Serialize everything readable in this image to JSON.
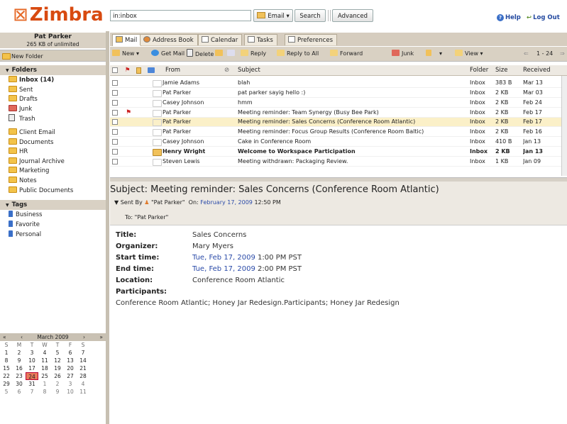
{
  "header": {
    "logo_text": "Zimbra",
    "search_value": "in:inbox",
    "email_button": "Email",
    "search_button": "Search",
    "advanced_button": "Advanced",
    "help_link": "Help",
    "logout_link": "Log Out"
  },
  "user": {
    "name": "Pat Parker",
    "quota": "265 KB of unlimited"
  },
  "sidebar": {
    "new_folder": "New Folder",
    "folders_header": "Folders",
    "folders": [
      {
        "label": "Inbox (14)",
        "bold": true
      },
      {
        "label": "Sent"
      },
      {
        "label": "Drafts"
      },
      {
        "label": "Junk"
      },
      {
        "label": "Trash"
      },
      {
        "label": "Client Email"
      },
      {
        "label": "Documents"
      },
      {
        "label": "HR"
      },
      {
        "label": "Journal Archive"
      },
      {
        "label": "Marketing"
      },
      {
        "label": "Notes"
      },
      {
        "label": "Public Documents"
      }
    ],
    "tags_header": "Tags",
    "tags": [
      {
        "label": "Business"
      },
      {
        "label": "Favorite"
      },
      {
        "label": "Personal"
      }
    ]
  },
  "calendar": {
    "month": "March 2009",
    "nav_prev_year": "«",
    "nav_prev": "‹",
    "nav_next": "›",
    "nav_next_year": "»",
    "weekdays": [
      "S",
      "M",
      "T",
      "W",
      "T",
      "F",
      "S"
    ],
    "weeks": [
      [
        "1",
        "2",
        "3",
        "4",
        "5",
        "6",
        "7"
      ],
      [
        "8",
        "9",
        "10",
        "11",
        "12",
        "13",
        "14"
      ],
      [
        "15",
        "16",
        "17",
        "18",
        "19",
        "20",
        "21"
      ],
      [
        "22",
        "23",
        "24",
        "25",
        "26",
        "27",
        "28"
      ],
      [
        "29",
        "30",
        "31",
        "1",
        "2",
        "3",
        "4"
      ],
      [
        "5",
        "6",
        "7",
        "8",
        "9",
        "10",
        "11"
      ]
    ],
    "today": "24"
  },
  "tabs": [
    "Mail",
    "Address Book",
    "Calendar",
    "Tasks",
    "Preferences"
  ],
  "toolbar": {
    "new": "New",
    "get_mail": "Get Mail",
    "delete": "Delete",
    "reply": "Reply",
    "reply_all": "Reply to All",
    "forward": "Forward",
    "junk": "Junk",
    "view": "View",
    "page_range": "1 - 24"
  },
  "list": {
    "columns": {
      "from": "From",
      "subject": "Subject",
      "folder": "Folder",
      "size": "Size",
      "received": "Received"
    },
    "rows": [
      {
        "from": "Jamie Adams",
        "subject": "blah",
        "folder": "Inbox",
        "size": "383 B",
        "received": "Mar 13"
      },
      {
        "from": "Pat Parker",
        "subject": "pat parker sayig hello :)",
        "folder": "Inbox",
        "size": "2 KB",
        "received": "Mar 03"
      },
      {
        "from": "Casey Johnson",
        "subject": "hmm",
        "folder": "Inbox",
        "size": "2 KB",
        "received": "Feb 24"
      },
      {
        "from": "Pat Parker",
        "subject": "Meeting reminder: Team Synergy (Busy Bee Park)",
        "folder": "Inbox",
        "size": "2 KB",
        "received": "Feb 17",
        "flagged": true
      },
      {
        "from": "Pat Parker",
        "subject": "Meeting reminder: Sales Concerns (Conference Room Atlantic)",
        "folder": "Inbox",
        "size": "2 KB",
        "received": "Feb 17",
        "selected": true
      },
      {
        "from": "Pat Parker",
        "subject": "Meeting reminder: Focus Group Results (Conference Room Baltic)",
        "folder": "Inbox",
        "size": "2 KB",
        "received": "Feb 16"
      },
      {
        "from": "Casey Johnson",
        "subject": "Cake in Conference Room",
        "folder": "Inbox",
        "size": "410 B",
        "received": "Jan 13"
      },
      {
        "from": "Henry Wright",
        "subject": "Welcome to Workspace Participation",
        "folder": "Inbox",
        "size": "2 KB",
        "received": "Jan 13",
        "unread": true
      },
      {
        "from": "Steven Lewis",
        "subject": "Meeting withdrawn: Packaging Review.",
        "folder": "Inbox",
        "size": "1 KB",
        "received": "Jan 09"
      }
    ]
  },
  "message": {
    "subject": "Subject: Meeting reminder: Sales Concerns (Conference Room Atlantic)",
    "sent_by_label": "Sent By",
    "sent_by": "\"Pat Parker\"",
    "on_label": "On:",
    "date": "February 17, 2009",
    "time": "12:50 PM",
    "to_label": "To:",
    "to": "\"Pat Parker\"",
    "fields": {
      "title_label": "Title:",
      "title": "Sales Concerns",
      "organizer_label": "Organizer:",
      "organizer": "Mary Myers",
      "start_label": "Start time:",
      "start_link": "Tue, Feb 17, 2009",
      "start_rest": " 1:00 PM PST",
      "end_label": "End time:",
      "end_link": "Tue, Feb 17, 2009",
      "end_rest": " 2:00 PM PST",
      "location_label": "Location:",
      "location": "Conference Room Atlantic",
      "participants_label": "Participants:",
      "participants": "Conference Room Atlantic; Honey Jar Redesign.Participants; Honey Jar Redesign"
    }
  }
}
